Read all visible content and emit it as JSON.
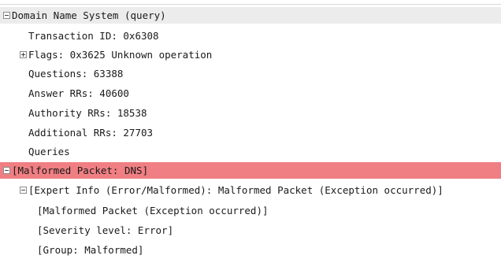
{
  "packet_details": {
    "dns": {
      "title": "Domain Name System (query)",
      "transaction_id": "Transaction ID: 0x6308",
      "flags": "Flags: 0x3625 Unknown operation",
      "questions": "Questions: 63388",
      "answer_rrs": "Answer RRs: 40600",
      "authority_rrs": "Authority RRs: 18538",
      "additional_rrs": "Additional RRs: 27703",
      "queries": "Queries"
    },
    "malformed": {
      "title": "[Malformed Packet: DNS]",
      "expert_info": "[Expert Info (Error/Malformed): Malformed Packet (Exception occurred)]",
      "exception": "[Malformed Packet (Exception occurred)]",
      "severity": "[Severity level: Error]",
      "group": "[Group: Malformed]"
    }
  },
  "colors": {
    "selected_row": "#ececec",
    "error_row": "#f07f83"
  },
  "icons": {
    "expanded": "minus-box-icon",
    "collapsed": "plus-box-icon"
  }
}
